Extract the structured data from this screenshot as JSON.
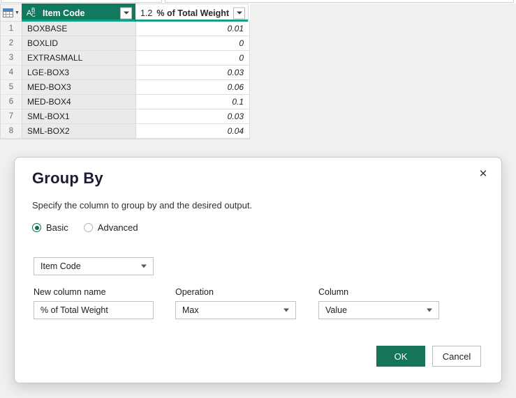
{
  "grid": {
    "corner_icon": "table-icon",
    "columns": [
      {
        "type_icon": "abc-text-type-icon",
        "type_label": "ABC",
        "name": "Item Code",
        "selected": true
      },
      {
        "type_icon": "decimal-number-type-icon",
        "type_label": "1.2",
        "name": "% of Total Weight",
        "selected": false
      }
    ],
    "rows": [
      {
        "n": "1",
        "item_code": "BOXBASE",
        "pct": "0.01"
      },
      {
        "n": "2",
        "item_code": "BOXLID",
        "pct": "0"
      },
      {
        "n": "3",
        "item_code": "EXTRASMALL",
        "pct": "0"
      },
      {
        "n": "4",
        "item_code": "LGE-BOX3",
        "pct": "0.03"
      },
      {
        "n": "5",
        "item_code": "MED-BOX3",
        "pct": "0.06"
      },
      {
        "n": "6",
        "item_code": "MED-BOX4",
        "pct": "0.1"
      },
      {
        "n": "7",
        "item_code": "SML-BOX1",
        "pct": "0.03"
      },
      {
        "n": "8",
        "item_code": "SML-BOX2",
        "pct": "0.04"
      }
    ]
  },
  "dialog": {
    "title": "Group By",
    "subtitle": "Specify the column to group by and the desired output.",
    "close_icon": "close-icon",
    "modes": [
      {
        "label": "Basic",
        "selected": true
      },
      {
        "label": "Advanced",
        "selected": false
      }
    ],
    "group_by": {
      "value": "Item Code"
    },
    "fields": [
      {
        "label": "New column name",
        "value": "% of Total Weight",
        "kind": "text"
      },
      {
        "label": "Operation",
        "value": "Max",
        "kind": "dropdown"
      },
      {
        "label": "Column",
        "value": "Value",
        "kind": "dropdown"
      }
    ],
    "buttons": {
      "ok": "OK",
      "cancel": "Cancel"
    },
    "colors": {
      "primary": "#15755a",
      "header_teal": "#117A5E",
      "accent_underline": "#16a085"
    }
  }
}
